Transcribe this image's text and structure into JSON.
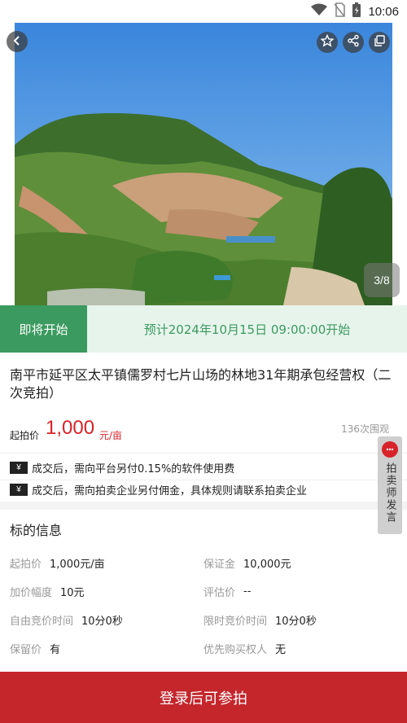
{
  "status_bar": {
    "time": "10:06"
  },
  "hero": {
    "counter": "3/8",
    "icons": [
      "back-icon",
      "star-icon",
      "share-icon",
      "copy-icon"
    ]
  },
  "banner": {
    "status": "即将开始",
    "start_text": "预计2024年10月15日 09:00:00开始"
  },
  "listing": {
    "title": "南平市延平区太平镇儒罗村七片山场的林地31年期承包经营权（二次竞拍）",
    "price_label": "起拍价",
    "price_value": "1,000",
    "price_unit": "元/亩",
    "views": "136次围观"
  },
  "notices": [
    {
      "icon": "¥",
      "text": "成交后，需向平台另付0.15%的软件使用费"
    },
    {
      "icon": "¥",
      "text": "成交后，需向拍卖企业另付佣金，具体规则请联系拍卖企业"
    }
  ],
  "info": {
    "title": "标的信息",
    "items": [
      {
        "label": "起拍价",
        "value": "1,000元/亩"
      },
      {
        "label": "保证金",
        "value": "10,000元"
      },
      {
        "label": "加价幅度",
        "value": "10元"
      },
      {
        "label": "评估价",
        "value": "--"
      },
      {
        "label": "自由竞价时间",
        "value": "10分0秒"
      },
      {
        "label": "限时竞价时间",
        "value": "10分0秒"
      },
      {
        "label": "保留价",
        "value": "有"
      },
      {
        "label": "优先购买权人",
        "value": "无"
      }
    ]
  },
  "side_tab": {
    "label": "拍卖师发言"
  },
  "cta": {
    "label": "登录后可参拍"
  },
  "colors": {
    "accent_red": "#c4262c",
    "accent_green": "#3b9a5f",
    "banner_bg": "#e7f4ec"
  }
}
